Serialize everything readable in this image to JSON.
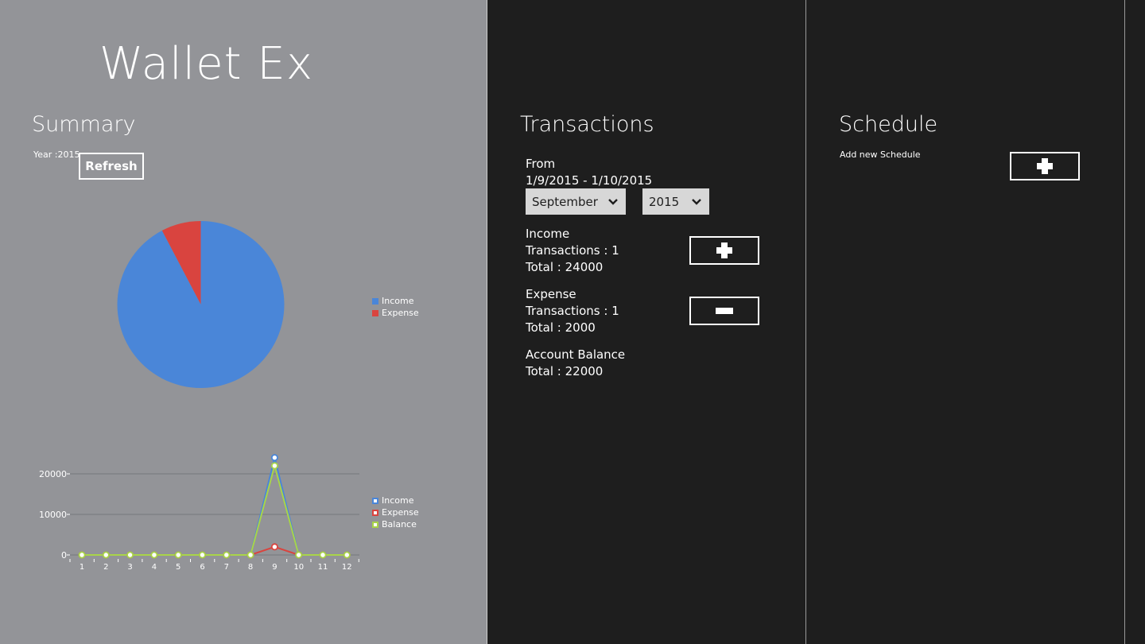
{
  "app": {
    "title": "Wallet Ex"
  },
  "summary": {
    "title": "Summary",
    "year_label": "Year :2015",
    "refresh_label": "Refresh"
  },
  "colors": {
    "income": "#4a86d8",
    "expense": "#d9443f",
    "balance": "#a8d449",
    "summary_bg": "#939498",
    "dark_bg": "#1e1e1e"
  },
  "chart_data": [
    {
      "type": "pie",
      "labels": [
        "Income",
        "Expense"
      ],
      "values": [
        24000,
        2000
      ],
      "colors": [
        "#4a86d8",
        "#d9443f"
      ],
      "legend": "right"
    },
    {
      "type": "line",
      "x": [
        1,
        2,
        3,
        4,
        5,
        6,
        7,
        8,
        9,
        10,
        11,
        12
      ],
      "series": [
        {
          "name": "Income",
          "values": [
            0,
            0,
            0,
            0,
            0,
            0,
            0,
            0,
            24000,
            0,
            0,
            0
          ],
          "color": "#4a86d8"
        },
        {
          "name": "Expense",
          "values": [
            0,
            0,
            0,
            0,
            0,
            0,
            0,
            0,
            2000,
            0,
            0,
            0
          ],
          "color": "#d9443f"
        },
        {
          "name": "Balance",
          "values": [
            0,
            0,
            0,
            0,
            0,
            0,
            0,
            0,
            22000,
            0,
            0,
            0
          ],
          "color": "#a8d449"
        }
      ],
      "yticks": [
        0,
        10000,
        20000
      ],
      "ylim": [
        0,
        24000
      ],
      "grid": true,
      "legend": "right"
    }
  ],
  "transactions": {
    "title": "Transactions",
    "from_label": "From",
    "date_range": "1/9/2015 - 1/10/2015",
    "month_select": "September",
    "year_select": "2015",
    "income": {
      "label": "Income",
      "count_text": "Transactions : 1",
      "total_text": "Total : 24000",
      "button_icon": "plus-icon"
    },
    "expense": {
      "label": "Expense",
      "count_text": "Transactions : 1",
      "total_text": "Total : 2000",
      "button_icon": "minus-icon"
    },
    "balance": {
      "label": "Account Balance",
      "total_text": "Total : 22000"
    }
  },
  "schedule": {
    "title": "Schedule",
    "add_label": "Add new Schedule",
    "button_icon": "plus-icon"
  }
}
